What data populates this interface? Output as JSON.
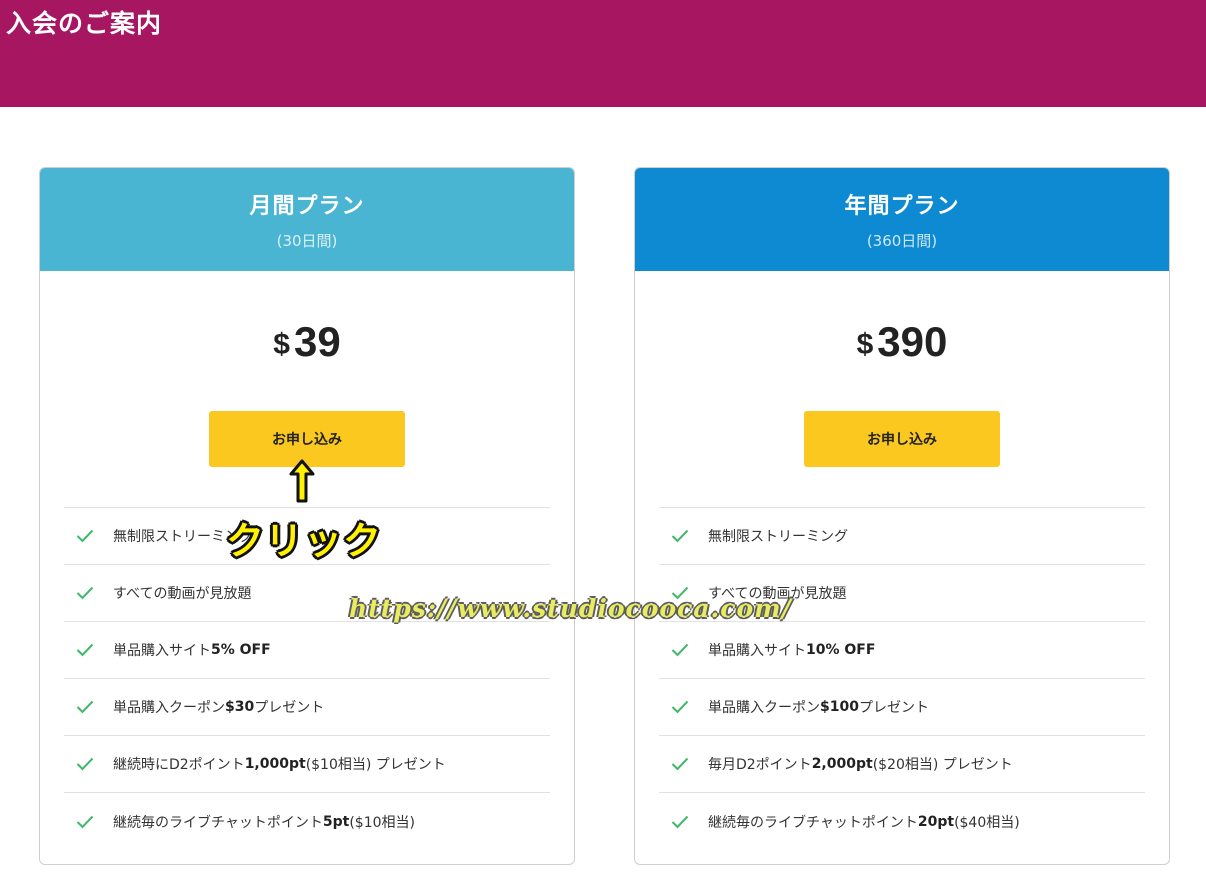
{
  "header": {
    "title": "入会のご案内"
  },
  "plans": [
    {
      "name": "月間プラン",
      "period": "(30日間)",
      "currency": "$",
      "price": "39",
      "button": "お申し込み",
      "features": [
        {
          "text": "無制限ストリーミング",
          "bold": "",
          "tail": ""
        },
        {
          "text": "すべての動画が見放題",
          "bold": "",
          "tail": ""
        },
        {
          "text": "単品購入サイト ",
          "bold": "5% OFF",
          "tail": ""
        },
        {
          "text": "単品購入クーポン ",
          "bold": "$30",
          "tail": " プレゼント"
        },
        {
          "text": "継続時にD2ポイント ",
          "bold": "1,000pt",
          "tail": " ($10相当) プレゼント"
        },
        {
          "text": "継続毎のライブチャットポイント ",
          "bold": "5pt",
          "tail": " ($10相当)"
        }
      ]
    },
    {
      "name": "年間プラン",
      "period": "(360日間)",
      "currency": "$",
      "price": "390",
      "button": "お申し込み",
      "features": [
        {
          "text": "無制限ストリーミング",
          "bold": "",
          "tail": ""
        },
        {
          "text": "すべての動画が見放題",
          "bold": "",
          "tail": ""
        },
        {
          "text": "単品購入サイト ",
          "bold": "10% OFF",
          "tail": ""
        },
        {
          "text": "単品購入クーポン ",
          "bold": "$100",
          "tail": " プレゼント"
        },
        {
          "text": "毎月D2ポイント ",
          "bold": "2,000pt",
          "tail": " ($20相当) プレゼント"
        },
        {
          "text": "継続毎のライブチャットポイント ",
          "bold": "20pt",
          "tail": " ($40相当)"
        }
      ]
    }
  ],
  "overlay": {
    "click_label": "クリック",
    "watermark": "https://www.studiocooca.com/"
  },
  "colors": {
    "header_bg": "#a71660",
    "monthly_head": "#49b5d2",
    "yearly_head": "#0e8ad3",
    "button": "#fbc81f",
    "check": "#3fb86a"
  },
  "icons": {
    "feature": "check-icon",
    "annotation": "up-arrow-icon"
  }
}
